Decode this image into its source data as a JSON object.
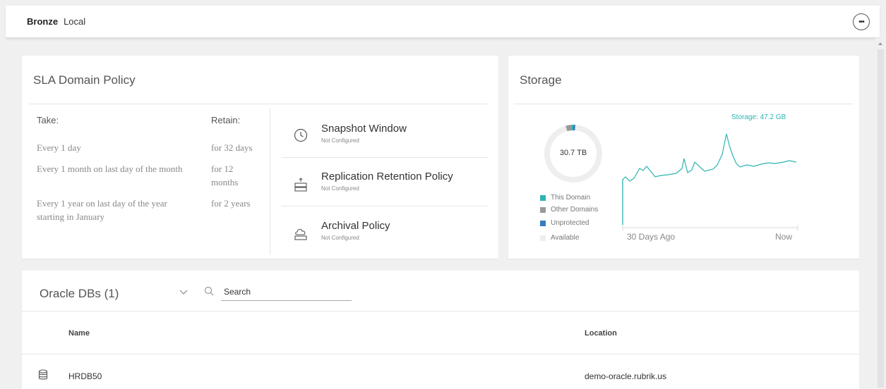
{
  "breadcrumb": {
    "sla_name": "Bronze",
    "scope": "Local"
  },
  "header": {
    "more_label": "•••",
    "more_icon": "more-options-icon"
  },
  "sla_policy": {
    "title": "SLA Domain Policy",
    "take_header": "Take:",
    "retain_header": "Retain:",
    "rules": [
      {
        "take": "Every 1 day",
        "retain": "for 32 days"
      },
      {
        "take": "Every 1 month on last day of the month",
        "retain": "for 12 months"
      },
      {
        "take": "Every 1 year on last day of the year starting in January",
        "retain": "for 2 years"
      }
    ],
    "policies": [
      {
        "title": "Snapshot Window",
        "status": "Not Configured",
        "icon": "clock-icon"
      },
      {
        "title": "Replication Retention Policy",
        "status": "Not Configured",
        "icon": "replication-icon"
      },
      {
        "title": "Archival Policy",
        "status": "Not Configured",
        "icon": "cloud-archive-icon"
      }
    ]
  },
  "storage": {
    "title": "Storage",
    "total": "30.7 TB",
    "storage_label": "Storage: 47.2 GB",
    "legend": [
      {
        "label": "This Domain",
        "color": "#2eb3b3"
      },
      {
        "label": "Other Domains",
        "color": "#999999"
      },
      {
        "label": "Unprotected",
        "color": "#3a7bbf"
      },
      {
        "label": "Available",
        "color": "#eeeeee"
      }
    ],
    "x_start_label": "30 Days Ago",
    "x_end_label": "Now",
    "line_color": "#2eb3b3"
  },
  "oracle": {
    "title": "Oracle DBs (1)",
    "search_placeholder": "Search",
    "columns": {
      "name": "Name",
      "location": "Location"
    },
    "rows": [
      {
        "name": "HRDB50",
        "location": "demo-oracle.rubrik.us",
        "icon": "database-icon"
      }
    ]
  }
}
